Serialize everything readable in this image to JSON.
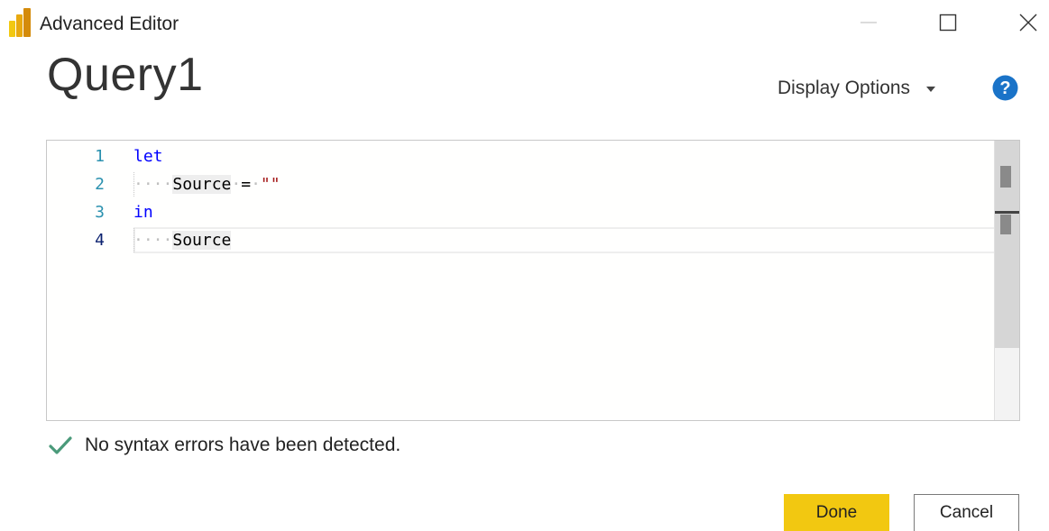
{
  "window": {
    "title": "Advanced Editor",
    "logo_icon": "powerbi-logo-icon",
    "controls": {
      "minimize_icon": "minimize-icon",
      "maximize_icon": "maximize-icon",
      "close_icon": "close-icon"
    }
  },
  "header": {
    "query_name": "Query1",
    "display_options_label": "Display Options",
    "display_options_icon": "chevron-down-icon",
    "help_icon": "help-icon"
  },
  "editor": {
    "lines": [
      {
        "number": "1",
        "keyword": "let"
      },
      {
        "number": "2",
        "indent": "····",
        "identifier": "Source",
        "operator": "=",
        "string": "\"\""
      },
      {
        "number": "3",
        "keyword": "in"
      },
      {
        "number": "4",
        "indent": "····",
        "identifier": "Source"
      }
    ],
    "active_line": "4"
  },
  "status": {
    "icon": "checkmark-icon",
    "message": "No syntax errors have been detected."
  },
  "buttons": {
    "done_label": "Done",
    "cancel_label": "Cancel"
  },
  "colors": {
    "accent": "#f2c811",
    "keyword": "#0000ff",
    "string": "#a31515",
    "line_number": "#2b91af",
    "success": "#4a9a7a",
    "help": "#1a73c8"
  }
}
